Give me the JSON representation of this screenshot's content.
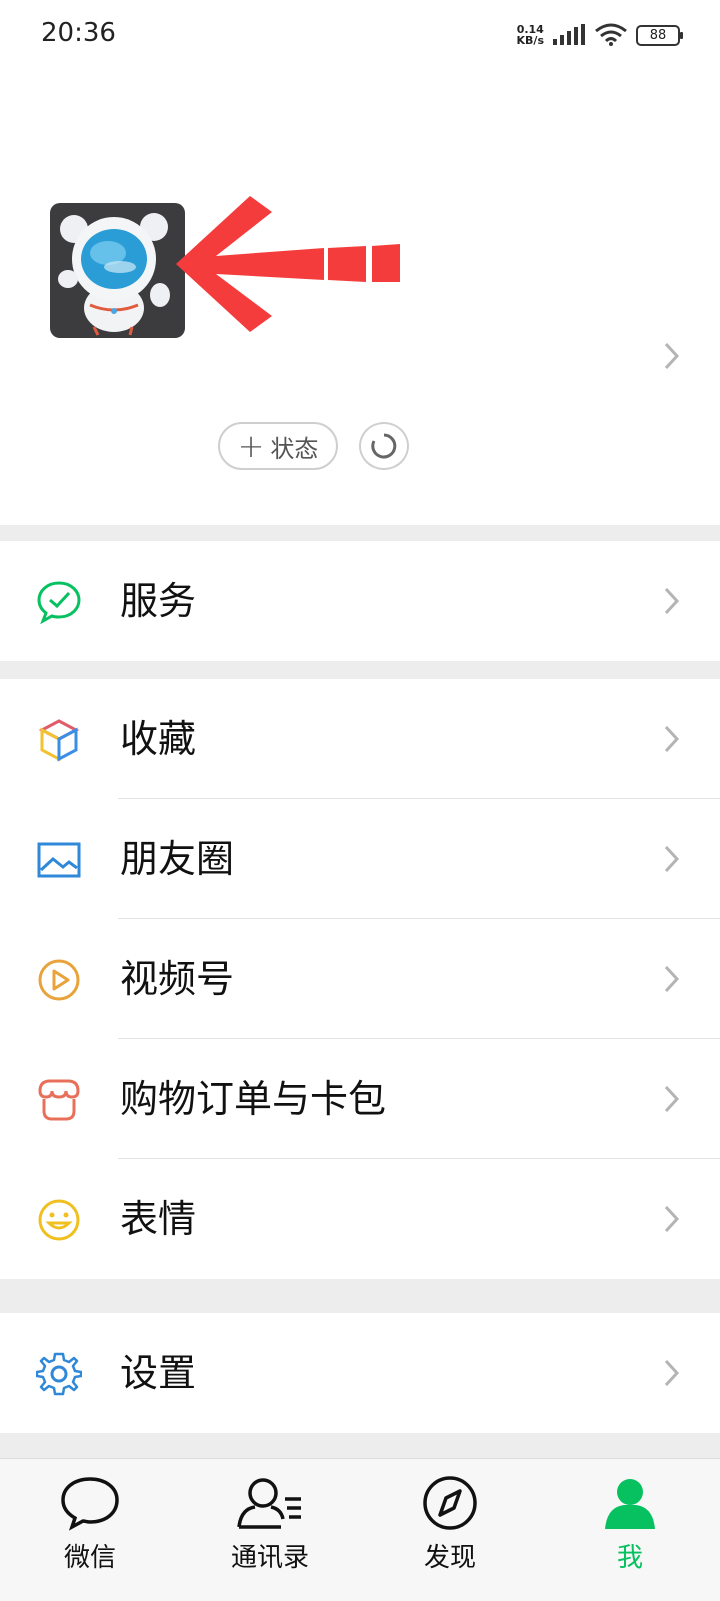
{
  "status_bar": {
    "time": "20:36",
    "net_speed_value": "0.14",
    "net_speed_unit": "KB/s",
    "battery": "88",
    "signal_icon": "signal-bars-icon",
    "wifi_icon": "wifi-icon"
  },
  "profile": {
    "avatar_icon": "astronaut-avatar",
    "status_button_label": "状态",
    "refresh_icon": "refresh-icon"
  },
  "menu": {
    "service": "服务",
    "favorites": "收藏",
    "moments": "朋友圈",
    "channels": "视频号",
    "orders": "购物订单与卡包",
    "stickers": "表情",
    "settings": "设置"
  },
  "tabs": [
    {
      "label": "微信",
      "icon": "chat-bubble-icon"
    },
    {
      "label": "通讯录",
      "icon": "contacts-icon"
    },
    {
      "label": "发现",
      "icon": "compass-icon"
    },
    {
      "label": "我",
      "icon": "me-icon",
      "active": true
    }
  ],
  "colors": {
    "accent": "#07c160",
    "arrow": "#f53c3c",
    "background": "#ededed"
  }
}
